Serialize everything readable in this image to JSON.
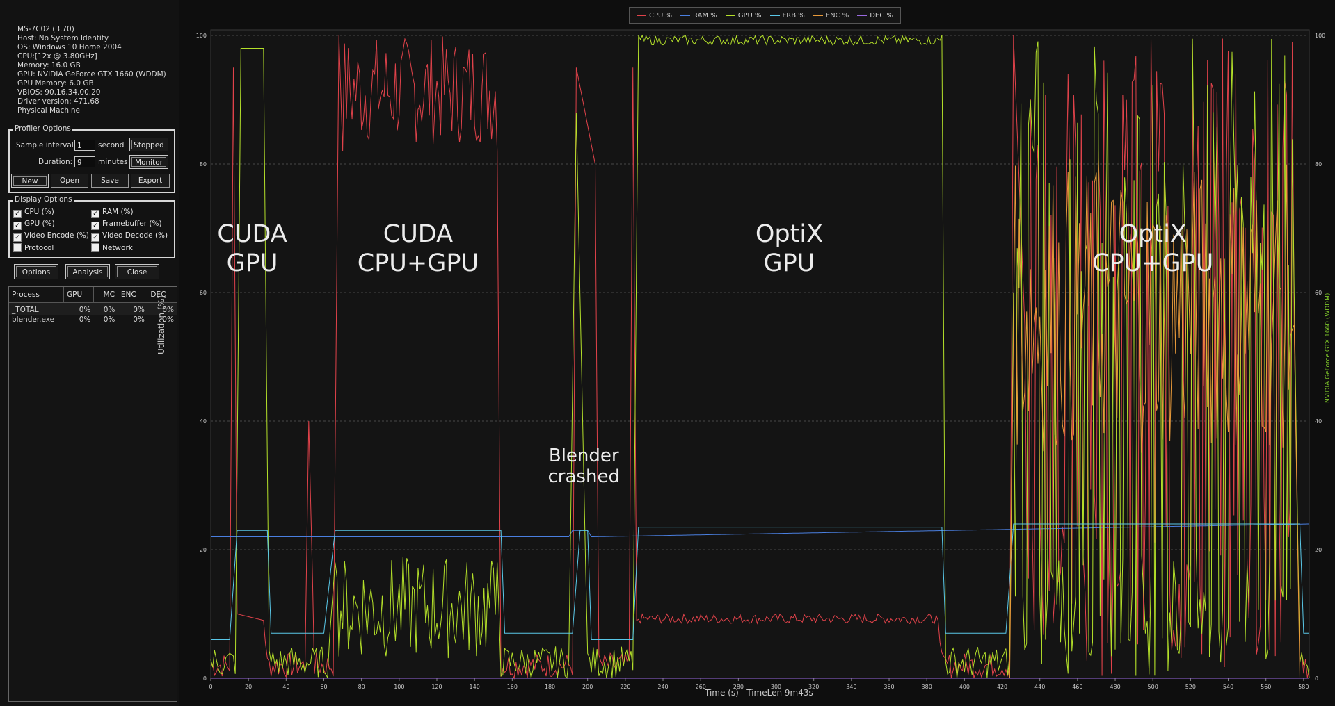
{
  "system_info": [
    "MS-7C02 (3.70)",
    "Host: No System Identity",
    "OS: Windows 10 Home 2004",
    "CPU:[12x @ 3.80GHz]",
    "Memory: 16.0 GB",
    "GPU: NVIDIA GeForce GTX 1660 (WDDM)",
    "GPU Memory: 6.0 GB",
    "VBIOS: 90.16.34.00.20",
    "Driver version: 471.68",
    "Physical Machine"
  ],
  "profiler": {
    "title": "Profiler Options",
    "sample_label": "Sample interval:",
    "sample_value": "1",
    "sample_unit": "second",
    "duration_label": "Duration:",
    "duration_value": "9",
    "duration_unit": "minutes",
    "stopped_button": "Stopped",
    "monitor_button": "Monitor",
    "new_button": "New",
    "open_button": "Open",
    "save_button": "Save",
    "export_button": "Export"
  },
  "display": {
    "title": "Display Options",
    "options": [
      {
        "label": "CPU (%)",
        "checked": true
      },
      {
        "label": "RAM (%)",
        "checked": true
      },
      {
        "label": "GPU (%)",
        "checked": true
      },
      {
        "label": "Framebuffer (%)",
        "checked": true
      },
      {
        "label": "Video Encode (%)",
        "checked": true
      },
      {
        "label": "Video Decode (%)",
        "checked": true
      },
      {
        "label": "Protocol",
        "checked": false
      },
      {
        "label": "Network",
        "checked": false
      }
    ]
  },
  "bottom_buttons": {
    "options": "Options",
    "analysis": "Analysis",
    "close": "Close"
  },
  "process_table": {
    "headers": [
      "Process",
      "GPU",
      "MC",
      "ENC",
      "DEC"
    ],
    "rows": [
      [
        "_TOTAL",
        "0%",
        "0%",
        "0%",
        "0%"
      ],
      [
        "blender.exe",
        "0%",
        "0%",
        "0%",
        "0%"
      ]
    ]
  },
  "chart_data": {
    "type": "line",
    "legend": [
      {
        "name": "CPU %",
        "color": "#e0424a"
      },
      {
        "name": "RAM %",
        "color": "#4a7fe0"
      },
      {
        "name": "GPU %",
        "color": "#b4e02a"
      },
      {
        "name": "FRB %",
        "color": "#5ac8e8"
      },
      {
        "name": "ENC %",
        "color": "#e89a3a"
      },
      {
        "name": "DEC %",
        "color": "#9a6ae0"
      }
    ],
    "xlabel": "Time (s)",
    "timelen": "TimeLen 9m43s",
    "ylabel": "Utilization (%)",
    "right_label": "NVIDIA GeForce GTX 1660 (WDDM)",
    "xlim": [
      0,
      583
    ],
    "ylim": [
      0,
      100
    ],
    "xticks": [
      0,
      20,
      40,
      60,
      80,
      100,
      120,
      140,
      160,
      180,
      200,
      220,
      240,
      260,
      280,
      300,
      320,
      340,
      360,
      380,
      400,
      420,
      440,
      460,
      480,
      500,
      520,
      540,
      560,
      580
    ],
    "yticks": [
      0,
      20,
      40,
      60,
      80,
      100
    ],
    "annotations": [
      {
        "text": "CUDA\nGPU",
        "x": 22,
        "y": 67
      },
      {
        "text": "CUDA\nCPU+GPU",
        "x": 110,
        "y": 67
      },
      {
        "text": "Blender\ncrashed",
        "x": 198,
        "y": 33
      },
      {
        "text": "OptiX\nGPU",
        "x": 307,
        "y": 67
      },
      {
        "text": "OptiX\nCPU+GPU",
        "x": 500,
        "y": 67
      }
    ],
    "series": [
      {
        "name": "CPU %",
        "phases": [
          [
            0,
            0
          ],
          [
            10,
            0
          ],
          [
            12,
            95
          ],
          [
            14,
            10
          ],
          [
            28,
            9
          ],
          [
            30,
            2
          ],
          [
            50,
            2
          ],
          [
            52,
            40
          ],
          [
            55,
            3
          ],
          [
            65,
            3
          ],
          [
            68,
            100
          ],
          [
            70,
            82
          ],
          [
            152,
            82
          ],
          [
            154,
            0
          ],
          [
            192,
            0
          ],
          [
            194,
            95
          ],
          [
            204,
            80
          ],
          [
            206,
            2
          ],
          [
            222,
            2
          ],
          [
            224,
            95
          ],
          [
            226,
            9
          ],
          [
            386,
            9
          ],
          [
            388,
            2
          ],
          [
            424,
            2
          ],
          [
            426,
            100
          ],
          [
            432,
            55
          ],
          [
            575,
            55
          ],
          [
            578,
            2
          ],
          [
            583,
            0
          ]
        ]
      },
      {
        "name": "RAM %",
        "phases": [
          [
            0,
            22
          ],
          [
            190,
            22
          ],
          [
            192,
            23
          ],
          [
            200,
            23
          ],
          [
            202,
            22
          ],
          [
            583,
            24
          ]
        ]
      },
      {
        "name": "GPU %",
        "phases": [
          [
            0,
            1
          ],
          [
            13,
            1
          ],
          [
            16,
            98
          ],
          [
            28,
            98
          ],
          [
            31,
            2
          ],
          [
            62,
            2
          ],
          [
            66,
            18
          ],
          [
            152,
            18
          ],
          [
            154,
            2
          ],
          [
            190,
            2
          ],
          [
            194,
            88
          ],
          [
            200,
            2
          ],
          [
            224,
            2
          ],
          [
            227,
            100
          ],
          [
            388,
            100
          ],
          [
            390,
            2
          ],
          [
            424,
            2
          ],
          [
            426,
            60
          ],
          [
            575,
            60
          ],
          [
            578,
            1
          ],
          [
            583,
            0
          ]
        ]
      },
      {
        "name": "FRB %",
        "phases": [
          [
            0,
            6
          ],
          [
            10,
            6
          ],
          [
            14,
            23
          ],
          [
            30,
            23
          ],
          [
            32,
            7
          ],
          [
            60,
            7
          ],
          [
            66,
            23
          ],
          [
            154,
            23
          ],
          [
            156,
            7
          ],
          [
            192,
            7
          ],
          [
            196,
            23
          ],
          [
            200,
            23
          ],
          [
            202,
            6
          ],
          [
            224,
            6
          ],
          [
            227,
            23.5
          ],
          [
            388,
            23.5
          ],
          [
            390,
            7
          ],
          [
            422,
            7
          ],
          [
            426,
            24
          ],
          [
            578,
            24
          ],
          [
            580,
            7
          ],
          [
            583,
            7
          ]
        ]
      },
      {
        "name": "ENC %",
        "phases": [
          [
            0,
            0
          ],
          [
            424,
            0
          ],
          [
            426,
            55
          ],
          [
            575,
            55
          ],
          [
            578,
            0
          ],
          [
            583,
            0
          ]
        ]
      },
      {
        "name": "DEC %",
        "phases": [
          [
            0,
            0
          ],
          [
            583,
            0
          ]
        ]
      }
    ]
  }
}
